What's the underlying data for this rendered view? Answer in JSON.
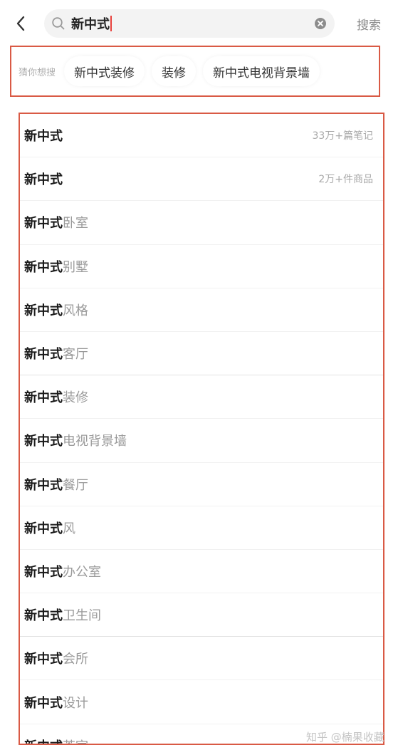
{
  "header": {
    "back_icon": "chevron-left-icon",
    "search": {
      "value": "新中式",
      "search_icon": "magnifier-icon",
      "clear_icon": "clear-circle-icon"
    },
    "search_button": "搜索"
  },
  "guess": {
    "label": "猜你想搜",
    "chips": [
      "新中式装修",
      "装修",
      "新中式电视背景墙"
    ]
  },
  "suggestions": [
    {
      "keyword": "新中式",
      "suffix": "",
      "meta": "33万+篇笔记"
    },
    {
      "keyword": "新中式",
      "suffix": "",
      "meta": "2万+件商品"
    },
    {
      "keyword": "新中式",
      "suffix": "卧室",
      "meta": ""
    },
    {
      "keyword": "新中式",
      "suffix": "别墅",
      "meta": ""
    },
    {
      "keyword": "新中式",
      "suffix": "风格",
      "meta": ""
    },
    {
      "keyword": "新中式",
      "suffix": "客厅",
      "meta": ""
    },
    {
      "keyword": "新中式",
      "suffix": "装修",
      "meta": ""
    },
    {
      "keyword": "新中式",
      "suffix": "电视背景墙",
      "meta": ""
    },
    {
      "keyword": "新中式",
      "suffix": "餐厅",
      "meta": ""
    },
    {
      "keyword": "新中式",
      "suffix": "风",
      "meta": ""
    },
    {
      "keyword": "新中式",
      "suffix": "办公室",
      "meta": ""
    },
    {
      "keyword": "新中式",
      "suffix": "卫生间",
      "meta": ""
    },
    {
      "keyword": "新中式",
      "suffix": "会所",
      "meta": ""
    },
    {
      "keyword": "新中式",
      "suffix": "设计",
      "meta": ""
    },
    {
      "keyword": "新中式",
      "suffix": "茶室",
      "meta": ""
    }
  ],
  "watermark": "知乎 @楠果收藏",
  "colors": {
    "highlight_border": "#d95a45",
    "caret": "#e8413c"
  }
}
